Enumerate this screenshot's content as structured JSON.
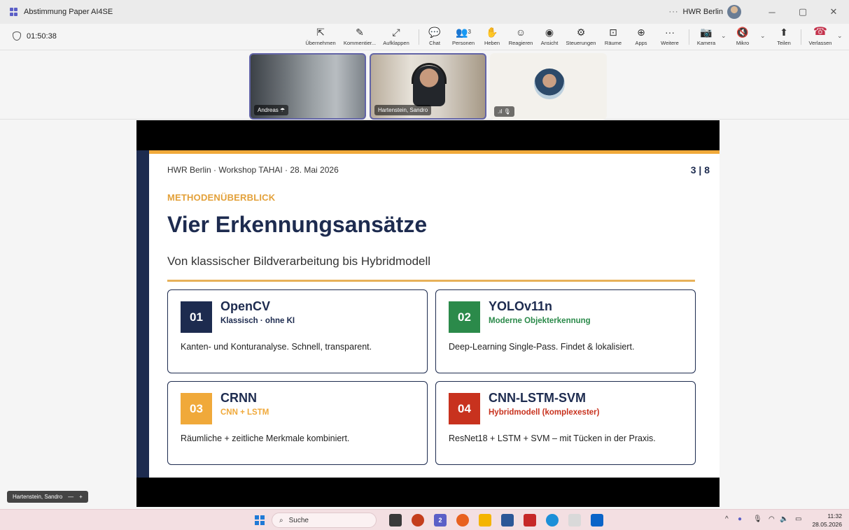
{
  "window": {
    "title": "Abstimmung Paper AI4SE",
    "org": "HWR Berlin",
    "more": "···",
    "minimize": "─",
    "restore": "▢",
    "close": "✕"
  },
  "meeting": {
    "timer": "01:50:38",
    "toolbar": [
      {
        "label": "Übernehmen",
        "icon": "⇱"
      },
      {
        "label": "Kommentier...",
        "icon": "✎"
      },
      {
        "label": "Aufklappen",
        "icon": "⤢"
      },
      {
        "label": "Chat",
        "icon": "💬"
      },
      {
        "label": "Personen",
        "icon": "👥",
        "badge": "3"
      },
      {
        "label": "Heben",
        "icon": "✋"
      },
      {
        "label": "Reagieren",
        "icon": "☺"
      },
      {
        "label": "Ansicht",
        "icon": "◉"
      },
      {
        "label": "Steuerungen",
        "icon": "⚙"
      },
      {
        "label": "Räume",
        "icon": "⊡"
      },
      {
        "label": "Apps",
        "icon": "⊕"
      },
      {
        "label": "Weitere",
        "icon": "···"
      }
    ],
    "camera": {
      "label": "Kamera",
      "icon": "📷"
    },
    "mic": {
      "label": "Mikro",
      "icon": "🔇"
    },
    "share": {
      "label": "Teilen",
      "icon": "⬆"
    },
    "leave": {
      "label": "Verlassen",
      "icon": "☎"
    },
    "chevron": "⌄"
  },
  "participants": [
    {
      "name": "Andreas",
      "icon": "☂"
    },
    {
      "name": "Hartenstein, Sandro"
    },
    {
      "name": "",
      "indicator": ".ıl  🎙"
    }
  ],
  "slide": {
    "meta": "HWR Berlin · Workshop TAHAI · 28. Mai 2026",
    "page": "3 | 8",
    "kicker": "METHODENÜBERBLICK",
    "title": "Vier Erkennungsansätze",
    "subtitle": "Von klassischer Bildverarbeitung bis Hybridmodell",
    "cards": [
      {
        "num": "01",
        "title": "OpenCV",
        "sub": "Klassisch · ohne KI",
        "desc": "Kanten- und Konturanalyse. Schnell, transparent.",
        "color": "#1d2b4f"
      },
      {
        "num": "02",
        "title": "YOLOv11n",
        "sub": "Moderne Objekterkennung",
        "desc": "Deep-Learning Single-Pass. Findet & lokalisiert.",
        "color": "#2b8a4a"
      },
      {
        "num": "03",
        "title": "CRNN",
        "sub": "CNN + LSTM",
        "desc": "Räumliche + zeitliche Merkmale kombiniert.",
        "color": "#f0a93a"
      },
      {
        "num": "04",
        "title": "CNN-LSTM-SVM",
        "sub": "Hybridmodell (komplexester)",
        "desc": "ResNet18 + LSTM + SVM – mit Tücken in der Praxis.",
        "color": "#c8321e"
      }
    ]
  },
  "presenter_chip": {
    "name": "Hartenstein, Sandro",
    "minus": "—",
    "plus": "+"
  },
  "taskbar": {
    "search_placeholder": "Suche",
    "search_icon": "⌕",
    "teams_badge": "2",
    "tray_icons": "^",
    "time": "11:32",
    "date": "28.05.2026"
  }
}
